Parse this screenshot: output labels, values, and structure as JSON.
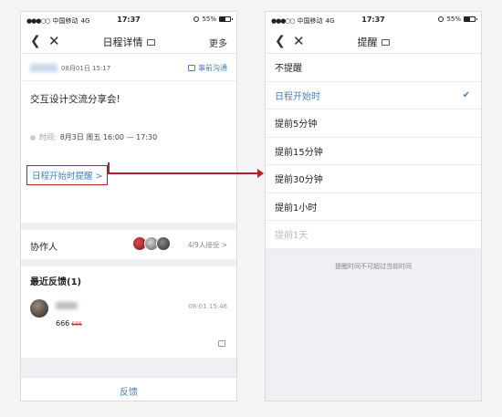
{
  "status_bar": {
    "carrier": "中国移动",
    "network": "4G",
    "time": "17:37",
    "battery": "55%",
    "battery_level": 0.55
  },
  "left_screen": {
    "nav": {
      "back_icon": "chevron-left",
      "close_icon": "close",
      "title": "日程详情",
      "more": "更多"
    },
    "meta": {
      "date": "08月01日 15:17",
      "link": "事前沟通"
    },
    "event_title": "交互设计交流分享会!",
    "time_label": "时间:",
    "time_value": "8月3日 周五 16:00 — 17:30",
    "reminder_link": "日程开始时提醒 >",
    "collaborators_label": "协作人",
    "accepted": "4/9人接受 >",
    "feedback_title": "最近反馈(1)",
    "feedback": {
      "date": "08-01 15:46",
      "text": "666",
      "strike": "666"
    },
    "bottom_button": "反馈"
  },
  "right_screen": {
    "nav": {
      "back_icon": "chevron-left",
      "close_icon": "close",
      "title": "提醒"
    },
    "options": [
      {
        "label": "不提醒",
        "state": "normal"
      },
      {
        "label": "日程开始时",
        "state": "selected"
      },
      {
        "label": "提前5分钟",
        "state": "normal"
      },
      {
        "label": "提前15分钟",
        "state": "normal"
      },
      {
        "label": "提前30分钟",
        "state": "normal"
      },
      {
        "label": "提前1小时",
        "state": "normal"
      },
      {
        "label": "提前1天",
        "state": "disabled"
      }
    ],
    "hint": "提醒时间不可超过当前时间"
  },
  "colors": {
    "accent": "#4a7fb8",
    "highlight": "#b21f2d"
  }
}
